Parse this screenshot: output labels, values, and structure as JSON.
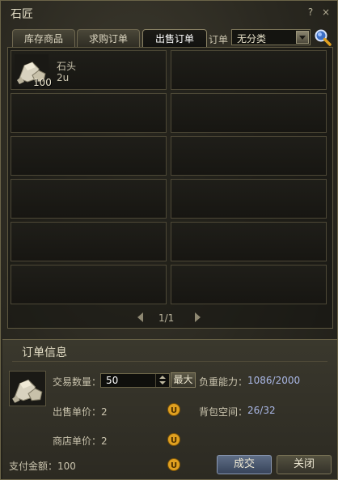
{
  "window": {
    "title": "石匠",
    "help_label": "?",
    "close_label": "×"
  },
  "tabs": [
    {
      "label": "库存商品",
      "active": false
    },
    {
      "label": "求购订单",
      "active": false
    },
    {
      "label": "出售订单",
      "active": true
    }
  ],
  "filter": {
    "label": "订单",
    "selected": "无分类"
  },
  "items": [
    {
      "name": "石头",
      "price": "2u",
      "quantity": "100",
      "icon": "stone-icon"
    }
  ],
  "pager": {
    "text": "1/1"
  },
  "order_info": {
    "title": "订单信息",
    "quantity_label": "交易数量：",
    "quantity_value": "50",
    "max_label": "最大",
    "load_label": "负重能力：",
    "load_value": "1086/2000",
    "sell_price_label": "出售单价：2",
    "bag_label": "背包空间：",
    "bag_value": "26/32",
    "shop_price_label": "商店单价：2",
    "pay_label": "支付金额：100",
    "deal_label": "成交",
    "close_label": "关闭"
  },
  "colors": {
    "accent_blue": "#aab8e6",
    "coin": "#e0a020"
  }
}
